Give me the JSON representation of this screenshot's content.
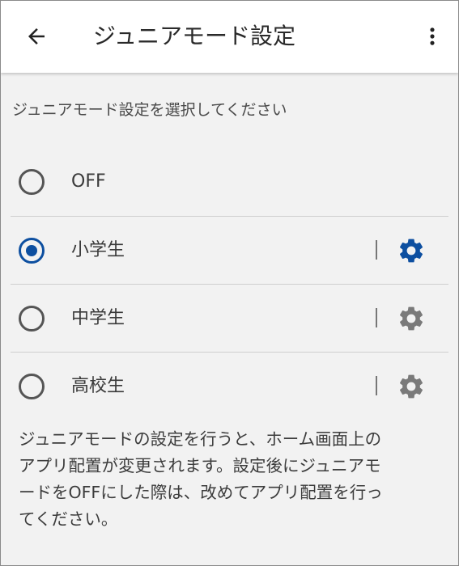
{
  "appbar": {
    "title": "ジュニアモード設定",
    "back_icon": "arrow-back-icon",
    "more_icon": "more-vert-icon"
  },
  "subtitle": "ジュニアモード設定を選択してください",
  "options": [
    {
      "label": "OFF",
      "selected": false,
      "has_settings": false
    },
    {
      "label": "小学生",
      "selected": true,
      "has_settings": true,
      "settings_icon": "gear-icon",
      "settings_color": "#0d4fa0"
    },
    {
      "label": "中学生",
      "selected": false,
      "has_settings": true,
      "settings_icon": "gear-icon",
      "settings_color": "#7a7a7a"
    },
    {
      "label": "高校生",
      "selected": false,
      "has_settings": true,
      "settings_icon": "gear-icon",
      "settings_color": "#7a7a7a"
    }
  ],
  "note_lines": [
    "ジュニアモードの設定を行うと、ホーム画面上の",
    "アプリ配置が変更されます。設定後にジュニアモ",
    "ードをOFFにした際は、改めてアプリ配置を行っ",
    "てください。"
  ],
  "colors": {
    "accent": "#0d4fa0",
    "inactive_icon": "#7a7a7a",
    "background": "#f2f2f2"
  }
}
